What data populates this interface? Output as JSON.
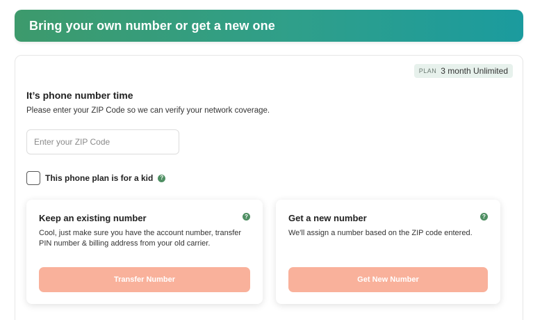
{
  "banner": {
    "title": "Bring your own number or get a new one"
  },
  "plan": {
    "label": "PLAN",
    "value": "3 month Unlimited"
  },
  "section": {
    "title": "It’s phone number time",
    "subtitle": "Please enter your ZIP Code so we can verify your network coverage."
  },
  "zip": {
    "placeholder": "Enter your ZIP Code",
    "value": ""
  },
  "kid": {
    "label": "This phone plan is for a kid",
    "checked": false
  },
  "icons": {
    "help": "?"
  },
  "cards": [
    {
      "title": "Keep an existing number",
      "description": "Cool, just make sure you have the account number, transfer PIN number & billing address from your old carrier.",
      "button": "Transfer Number"
    },
    {
      "title": "Get a new number",
      "description": "We'll assign a number based on the ZIP code entered.",
      "button": "Get New Number"
    }
  ],
  "colors": {
    "banner_start": "#3d9a6c",
    "banner_end": "#1b9b9e",
    "button_bg": "#f9b19b",
    "help_icon": "#4f8f63",
    "badge_bg": "#e7f1ec"
  }
}
